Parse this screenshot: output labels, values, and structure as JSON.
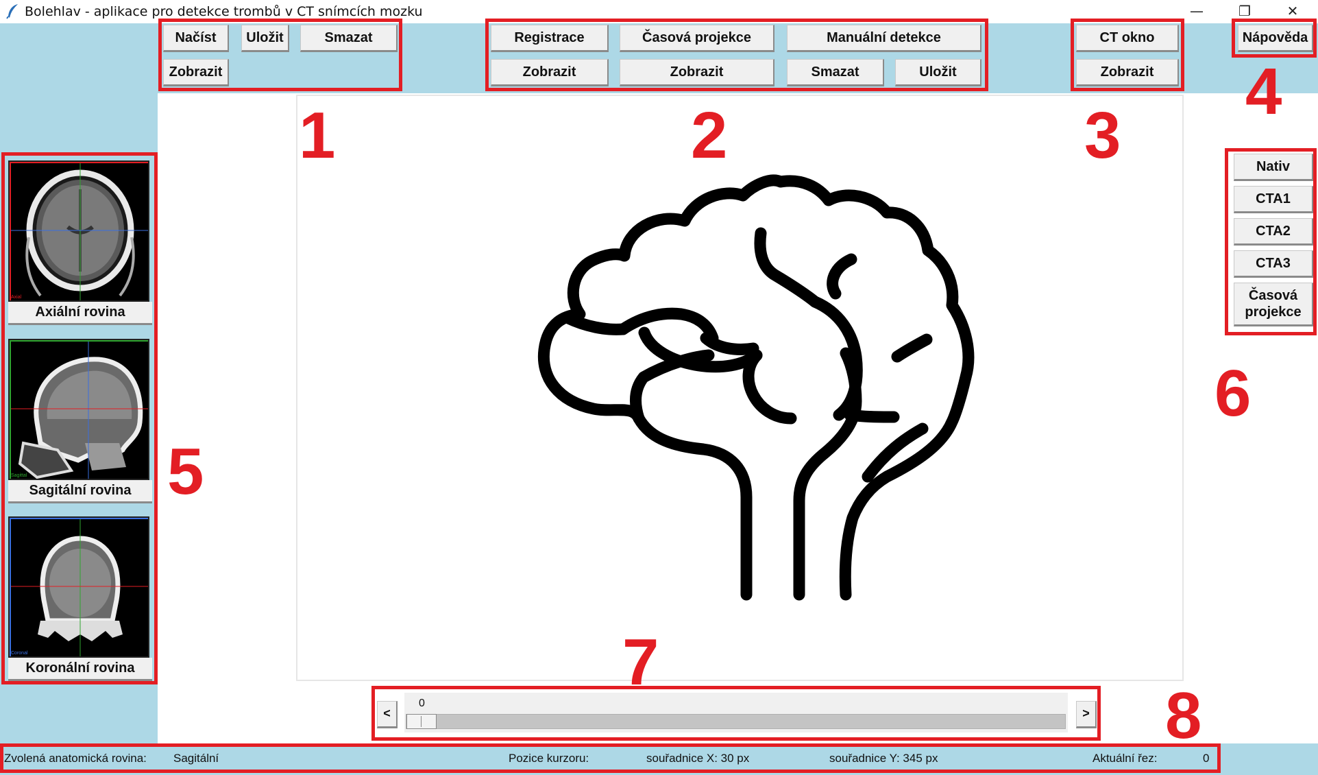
{
  "window": {
    "title": "Bolehlav - aplikace pro detekce trombů v CT snímcích mozku",
    "minimize_icon": "minimize-icon",
    "maximize_icon": "restore-icon",
    "close_icon": "close-icon",
    "minimize_glyph": "—",
    "restore_glyph": "❐",
    "close_glyph": "✕"
  },
  "toolbar_group1": {
    "load": "Načíst",
    "save": "Uložit",
    "delete": "Smazat",
    "show": "Zobrazit"
  },
  "toolbar_group2": {
    "registration": "Registrace",
    "time_projection": "Časová projekce",
    "manual_detection": "Manuální detekce",
    "show_registration": "Zobrazit",
    "show_time_projection": "Zobrazit",
    "delete_detection": "Smazat",
    "save_detection": "Uložit"
  },
  "toolbar_group3": {
    "ct_window": "CT okno",
    "show": "Zobrazit"
  },
  "help": "Nápověda",
  "planes": [
    {
      "label": "Axiální rovina",
      "tag": "Axial",
      "tag_color": "#e31e24"
    },
    {
      "label": "Sagitální rovina",
      "tag": "Sagittal",
      "tag_color": "#2fa52f"
    },
    {
      "label": "Koronální rovina",
      "tag": "Coronal",
      "tag_color": "#3a6fe0"
    }
  ],
  "series_buttons": [
    "Nativ",
    "CTA1",
    "CTA2",
    "CTA3",
    "Časová projekce"
  ],
  "slider": {
    "value": "0",
    "prev": "<",
    "next": ">",
    "position_fraction": 0
  },
  "annotations": [
    "1",
    "2",
    "3",
    "4",
    "5",
    "6",
    "7",
    "8"
  ],
  "status": {
    "plane_label": "Zvolená anatomická rovina:",
    "plane_value": "Sagitální",
    "cursor_label": "Pozice kurzoru:",
    "x_coord": "souřadnice X: 30 px",
    "y_coord": "souřadnice Y: 345 px",
    "slice_label": "Aktuální řez:",
    "slice_value": "0"
  },
  "colors": {
    "panel_background": "#add8e6",
    "annotation_red": "#e31e24",
    "button_face": "#f0f0f0"
  },
  "canvas_icon": "brain-icon"
}
